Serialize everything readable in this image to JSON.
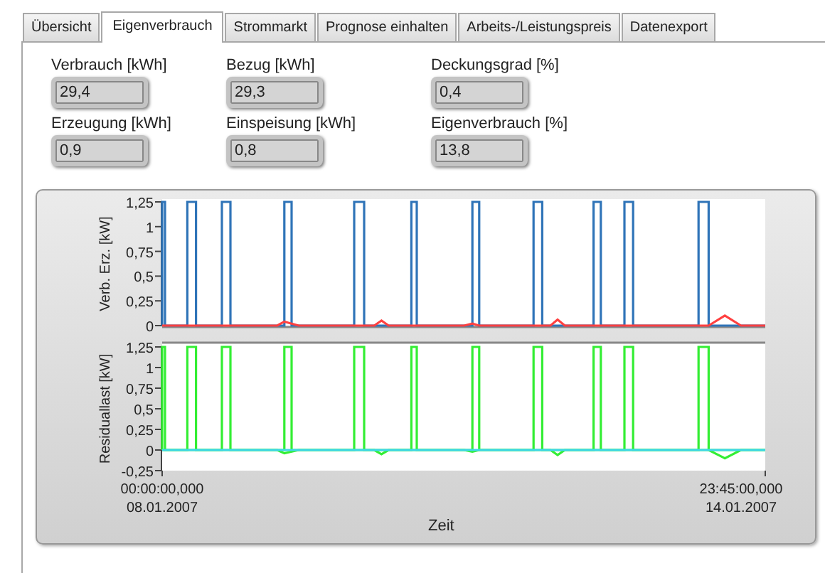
{
  "tabs": [
    {
      "label": "Übersicht",
      "selected": false
    },
    {
      "label": "Eigenverbrauch",
      "selected": true
    },
    {
      "label": "Strommarkt",
      "selected": false
    },
    {
      "label": "Prognose einhalten",
      "selected": false
    },
    {
      "label": "Arbeits-/Leistungspreis",
      "selected": false
    },
    {
      "label": "Datenexport",
      "selected": false
    }
  ],
  "fields": [
    {
      "label": "Verbrauch [kWh]",
      "value": "29,4"
    },
    {
      "label": "Bezug [kWh]",
      "value": "29,3"
    },
    {
      "label": "Deckungsgrad [%]",
      "value": "0,4"
    },
    {
      "label": "Erzeugung [kWh]",
      "value": "0,9"
    },
    {
      "label": "Einspeisung [kWh]",
      "value": "0,8"
    },
    {
      "label": "Eigenverbrauch [%]",
      "value": "13,8"
    }
  ],
  "graph": {
    "plots": [
      {
        "y_title": "Verb. Erz. [kW]",
        "y_ticks": [
          "1,25",
          "1",
          "0,75",
          "0,5",
          "0,25",
          "0"
        ]
      },
      {
        "y_title": "Residuallast [kW]",
        "y_ticks": [
          "1,25",
          "1",
          "0,75",
          "0,5",
          "0,25",
          "0",
          "-0,25"
        ]
      }
    ],
    "x_ticks": [
      {
        "time": "00:00:00,000",
        "date": "08.01.2007"
      },
      {
        "time": "23:45:00,000",
        "date": "14.01.2007"
      }
    ],
    "x_title": "Zeit"
  }
}
